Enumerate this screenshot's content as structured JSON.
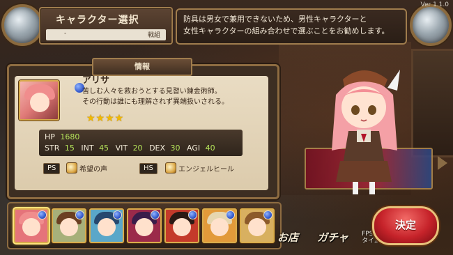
{
  "version": "Ver 1.1.0",
  "title": {
    "label": "キャラクター選択",
    "sub_dash": "-",
    "sub_tag": "戦組"
  },
  "notice": {
    "line1": "防具は男女で兼用できないため、男性キャラクターと",
    "line2": "女性キャラクターの組み合わせで選ぶことをお勧めします。"
  },
  "info": {
    "header": "情報",
    "name": "アリサ",
    "desc_line1": "苦しむ人々を救おうとする見習い錬金術師。",
    "desc_line2": "その行動は誰にも理解されず異端扱いされる。",
    "stars": "★★★★",
    "star_count": 4,
    "stats": {
      "hp_label": "HP",
      "hp": "1680",
      "str_label": "STR",
      "str": "15",
      "int_label": "INT",
      "int": "45",
      "vit_label": "VIT",
      "vit": "20",
      "dex_label": "DEX",
      "dex": "30",
      "agi_label": "AGI",
      "agi": "40"
    },
    "ps_label": "PS",
    "ps_skill": "希望の声",
    "hs_label": "HS",
    "hs_skill": "エンジェルヒール"
  },
  "roster": [
    {
      "hair": "#f08d8d",
      "bg": "#e5747a"
    },
    {
      "hair": "#6b3f22",
      "bg": "#a7b07a"
    },
    {
      "hair": "#27486e",
      "bg": "#5aa7c9"
    },
    {
      "hair": "#3a1d4a",
      "bg": "#9b2a4a"
    },
    {
      "hair": "#2b1a14",
      "bg": "#c43a2a"
    },
    {
      "hair": "#e6d6b0",
      "bg": "#e29a3a"
    },
    {
      "hair": "#8c5a2a",
      "bg": "#d8b060"
    }
  ],
  "menu": {
    "shop": "お店",
    "gacha": "ガチャ"
  },
  "fps": {
    "line1": "FPS:30",
    "line2": "タイムスケール:1.000"
  },
  "decide_label": "決定",
  "colors": {
    "frame_gold": "#a07d4d",
    "stat_value": "#b5e35a",
    "decide_red": "#c6232a"
  }
}
